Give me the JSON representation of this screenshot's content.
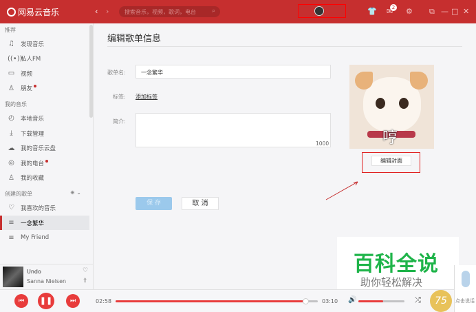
{
  "app": {
    "name": "网易云音乐"
  },
  "topbar": {
    "back": "‹",
    "forward": "›",
    "search_placeholder": "搜索音乐，视频，歌词，电台",
    "message_count": "2"
  },
  "sidebar": {
    "sections": [
      {
        "title": "推荐",
        "items": [
          {
            "label": "发现音乐",
            "icon": "♫"
          },
          {
            "label": "私人FM",
            "icon": "((•))"
          },
          {
            "label": "视频",
            "icon": "▭"
          },
          {
            "label": "朋友",
            "icon": "♙",
            "dot": true
          }
        ]
      },
      {
        "title": "我的音乐",
        "items": [
          {
            "label": "本地音乐",
            "icon": "◴"
          },
          {
            "label": "下载管理",
            "icon": "⤓"
          },
          {
            "label": "我的音乐云盘",
            "icon": "☁"
          },
          {
            "label": "我的电台",
            "icon": "◎",
            "dot": true
          },
          {
            "label": "我的收藏",
            "icon": "♙"
          }
        ]
      },
      {
        "title": "创建的歌单",
        "items": [
          {
            "label": "我喜欢的音乐",
            "icon": "♡"
          },
          {
            "label": "一念繁华",
            "icon": "≡",
            "active": true
          },
          {
            "label": "My Friend",
            "icon": "≡"
          }
        ]
      }
    ]
  },
  "now_playing": {
    "title": "Undo",
    "artist": "Sanna Nielsen"
  },
  "main": {
    "title": "编辑歌单信息",
    "name_label": "歌单名:",
    "name_value": "一念繁华",
    "tag_label": "标签:",
    "tag_link": "添加标签",
    "intro_label": "简介:",
    "intro_count": "1000",
    "cover_text": "哼",
    "edit_cover": "编辑封面",
    "save": "保 存",
    "cancel": "取 消"
  },
  "player": {
    "current_time": "02:58",
    "total_time": "03:10",
    "progress_percent": 94,
    "volume_percent": 53
  },
  "overlay": {
    "brand": "百科全说",
    "slogan": "助你轻松解决",
    "coin": "75",
    "voice": "点击说话"
  },
  "colors": {
    "brand": "#c62f2f",
    "accent": "#e83c3c"
  }
}
